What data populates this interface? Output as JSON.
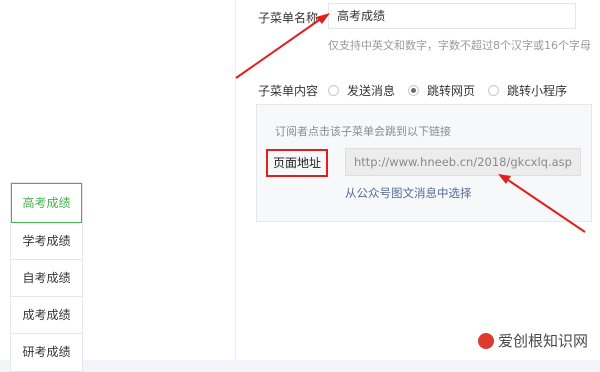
{
  "left_menu": {
    "items": [
      {
        "label": "高考成绩",
        "active": true
      },
      {
        "label": "学考成绩",
        "active": false
      },
      {
        "label": "自考成绩",
        "active": false
      },
      {
        "label": "成考成绩",
        "active": false
      },
      {
        "label": "研考成绩",
        "active": false
      }
    ]
  },
  "submenu": {
    "name_label": "子菜单名称",
    "name_value": "高考成绩",
    "name_hint": "仅支持中英文和数字，字数不超过8个汉字或16个字母",
    "content_label": "子菜单内容",
    "options": [
      {
        "label": "发送消息",
        "selected": false
      },
      {
        "label": "跳转网页",
        "selected": true
      },
      {
        "label": "跳转小程序",
        "selected": false
      }
    ],
    "box_tip": "订阅者点击该子菜单会跳到以下链接",
    "address_label": "页面地址",
    "address_value": "http://www.hneeb.cn/2018/gkcxlq.asp",
    "pick_link": "从公众号图文消息中选择"
  },
  "watermark": "爱创根知识网",
  "colors": {
    "accent_green": "#44b549",
    "annotation_red": "#e0201d",
    "link_blue": "#576b95"
  }
}
